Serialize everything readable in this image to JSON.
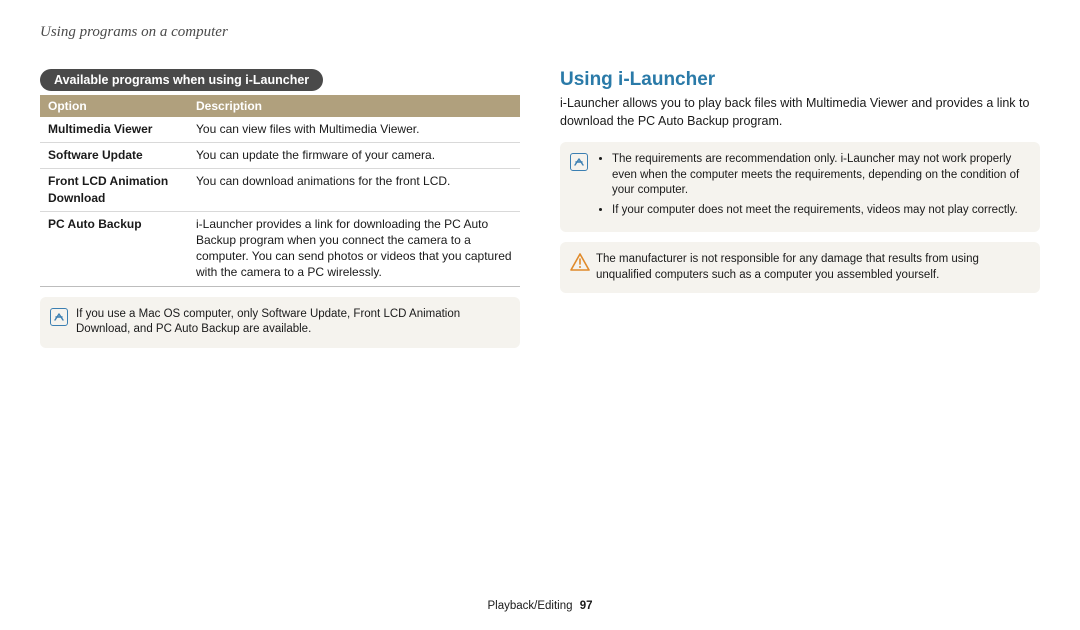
{
  "header": {
    "title": "Using programs on a computer"
  },
  "left": {
    "pill": "Available programs when using i-Launcher",
    "table": {
      "headers": [
        "Option",
        "Description"
      ],
      "rows": [
        {
          "option": "Multimedia Viewer",
          "description": "You can view files with Multimedia Viewer."
        },
        {
          "option": "Software Update",
          "description": "You can update the firmware of your camera."
        },
        {
          "option": "Front LCD Animation Download",
          "description": "You can download animations for the front LCD."
        },
        {
          "option": "PC Auto Backup",
          "description": "i-Launcher provides a link for downloading the PC Auto Backup program when you connect the camera to a computer. You can send photos or videos that you captured with the camera to a PC wirelessly."
        }
      ]
    },
    "note": "If you use a Mac OS computer, only Software Update, Front LCD Animation Download, and PC Auto Backup are available."
  },
  "right": {
    "title": "Using i-Launcher",
    "intro": "i-Launcher allows you to play back files with Multimedia Viewer and provides a link to download the PC Auto Backup program.",
    "note1": {
      "items": [
        "The requirements are recommendation only. i-Launcher may not work properly even when the computer meets the requirements, depending on the condition of your computer.",
        "If your computer does not meet the requirements, videos may not play correctly."
      ]
    },
    "warning": "The manufacturer is not responsible for any damage that results from using unqualified computers such as a computer you assembled yourself."
  },
  "footer": {
    "section": "Playback/Editing",
    "page": "97"
  }
}
